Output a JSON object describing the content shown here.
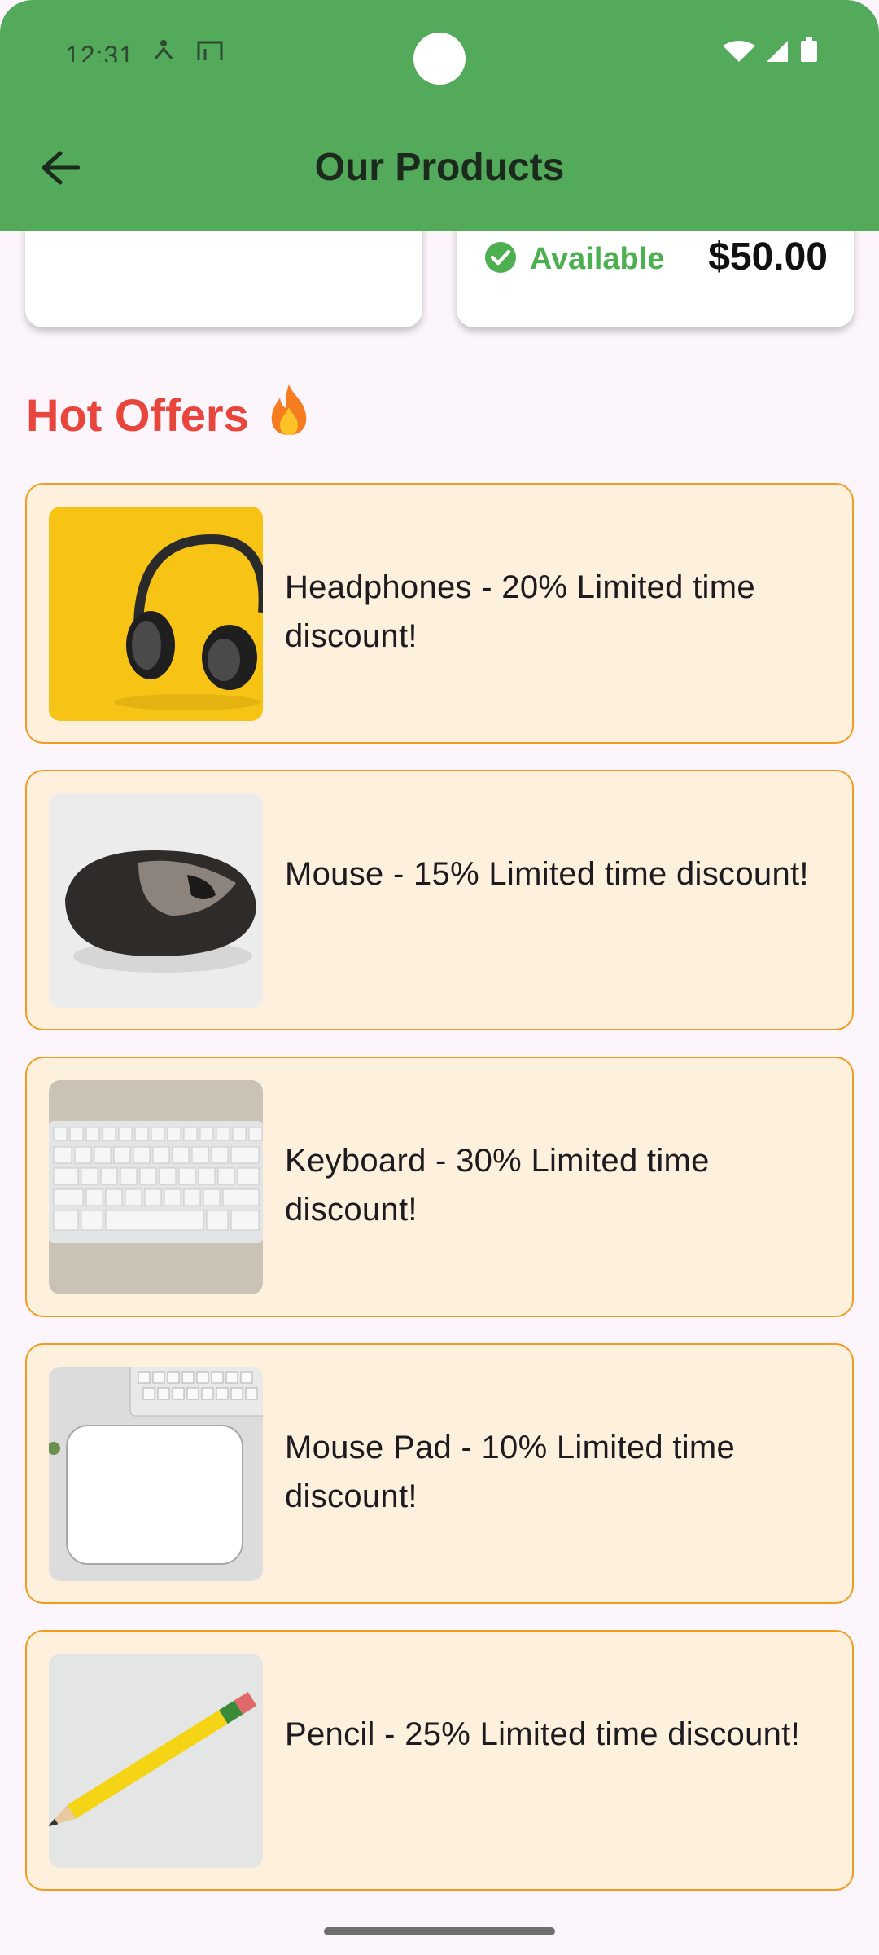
{
  "status_bar": {
    "time": "12:31",
    "icons": [
      "accessibility-icon",
      "screenshot-icon",
      "wifi-icon",
      "signal-icon",
      "battery-icon"
    ]
  },
  "app_bar": {
    "title": "Our Products",
    "back_icon": "arrow-back-icon",
    "background_color": "#52aa5a"
  },
  "products_partial": {
    "right_card": {
      "availability": "Available",
      "availability_color": "#4caf50",
      "price": "$50.00"
    }
  },
  "hot_offers": {
    "title": "Hot Offers",
    "title_icon": "fire-icon",
    "title_color": "#e8453c",
    "card_background": "#fdf0dd",
    "card_border": "#f29c1f",
    "items": [
      {
        "text": "Headphones - 20% Limited time discount!",
        "image": "headphones-image"
      },
      {
        "text": "Mouse - 15% Limited time discount!",
        "image": "mouse-image"
      },
      {
        "text": "Keyboard - 30% Limited time discount!",
        "image": "keyboard-image"
      },
      {
        "text": "Mouse Pad - 10% Limited time discount!",
        "image": "mouse-pad-image"
      },
      {
        "text": "Pencil - 25% Limited time discount!",
        "image": "pencil-image"
      }
    ]
  }
}
